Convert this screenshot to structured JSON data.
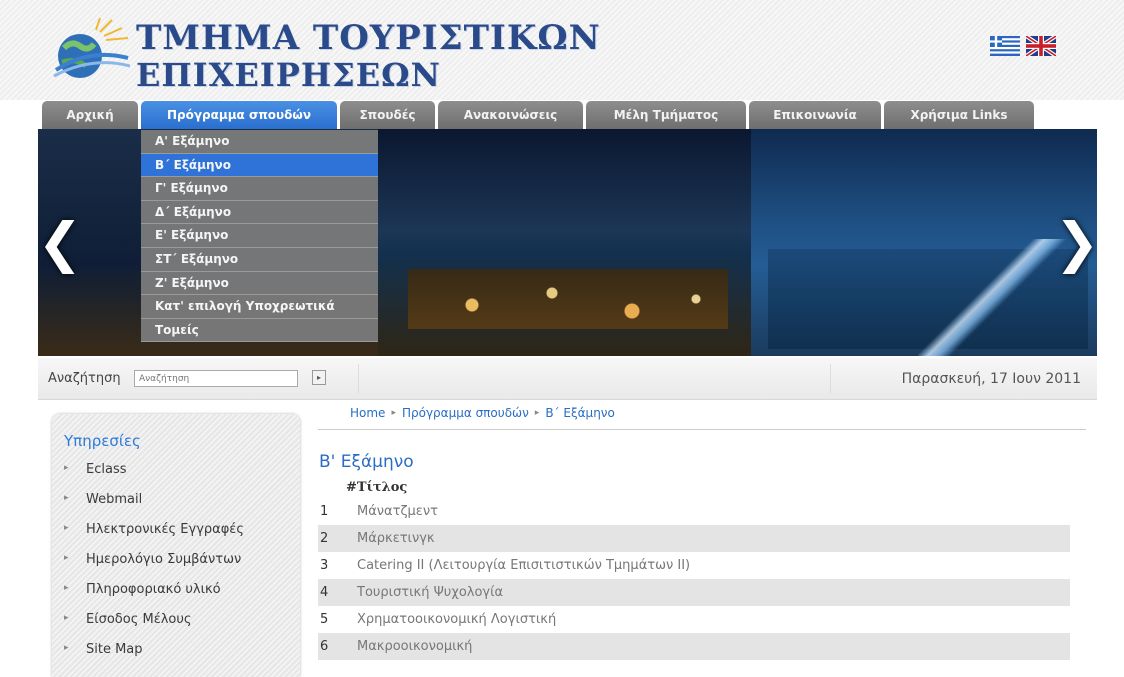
{
  "header": {
    "logo_line1": "ΤΜΗΜΑ ΤΟΥΡΙΣΤΙΚΩΝ",
    "logo_line2": "ΕΠΙΧΕΙΡΗΣΕΩΝ",
    "flags": [
      "greek-flag-icon",
      "uk-flag-icon"
    ]
  },
  "nav": {
    "tabs": [
      {
        "label": "Αρχική"
      },
      {
        "label": "Πρόγραμμα σπουδών",
        "active": true
      },
      {
        "label": "Σπουδές"
      },
      {
        "label": "Ανακοινώσεις"
      },
      {
        "label": "Μέλη Τμήματος"
      },
      {
        "label": "Επικοινωνία"
      },
      {
        "label": "Χρήσιμα Links"
      }
    ]
  },
  "dropdown": {
    "items": [
      {
        "label": "Α' Εξάμηνο"
      },
      {
        "label": "Β΄ Εξάμηνο",
        "selected": true
      },
      {
        "label": "Γ' Εξάμηνο"
      },
      {
        "label": "Δ΄ Εξάμηνο"
      },
      {
        "label": "Ε' Εξάμηνο"
      },
      {
        "label": "ΣΤ΄ Εξάμηνο"
      },
      {
        "label": "Ζ' Εξάμηνο"
      },
      {
        "label": "Κατ' επιλογή Υποχρεωτικά"
      },
      {
        "label": "Τομείς"
      }
    ]
  },
  "banner": {
    "prev": "❮",
    "next": "❯"
  },
  "search": {
    "label": "Αναζήτηση",
    "placeholder": "Αναζήτηση",
    "go": "▸"
  },
  "date": "Παρασκευή, 17 Ιουν 2011",
  "sidebar": {
    "title": "Υπηρεσίες",
    "bullet": "▸",
    "items": [
      {
        "label": "Eclass"
      },
      {
        "label": "Webmail"
      },
      {
        "label": "Ηλεκτρονικές Εγγραφές"
      },
      {
        "label": "Ημερολόγιο Συμβάντων"
      },
      {
        "label": "Πληροφοριακό υλικό"
      },
      {
        "label": "Είσοδος Μέλους"
      },
      {
        "label": "Site Map"
      }
    ]
  },
  "breadcrumb": {
    "home": "Home",
    "section": "Πρόγραμμα σπουδών",
    "current": "Β΄ Εξάμηνο",
    "sep": "▸"
  },
  "content": {
    "title": "Β' Εξάμηνο",
    "column_header": "#Τίτλος",
    "courses": [
      {
        "num": "1",
        "title": "Μάνατζμεντ"
      },
      {
        "num": "2",
        "title": "Μάρκετινγκ"
      },
      {
        "num": "3",
        "title": "Catering II (Λειτουργία Επισιτιστικών Τμημάτων II)"
      },
      {
        "num": "4",
        "title": "Τουριστική Ψυχολογία"
      },
      {
        "num": "5",
        "title": "Χρηματοοικονομική Λογιστική"
      },
      {
        "num": "6",
        "title": "Μακροοικονομική"
      }
    ]
  }
}
